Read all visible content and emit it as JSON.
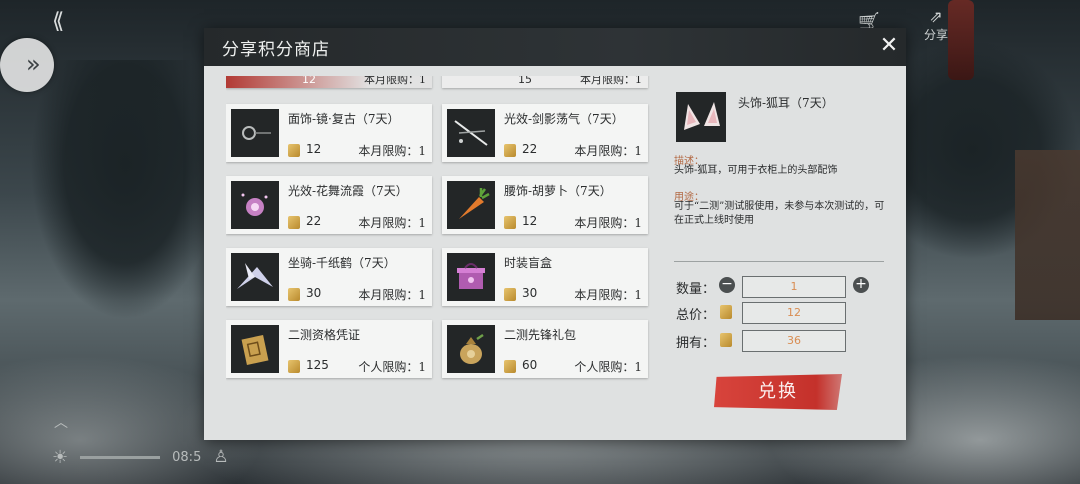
{
  "hud": {
    "time": "08:5",
    "share_label": "分享"
  },
  "shop": {
    "title": "分享积分商店",
    "items_partial": [
      {
        "price": "12",
        "limit": "本月限购：1"
      },
      {
        "price": "15",
        "limit": "本月限购：1"
      }
    ],
    "items": [
      {
        "name": "面饰-镜·复古（7天）",
        "price": "12",
        "limit": "本月限购：1",
        "icon": "monocle-icon"
      },
      {
        "name": "光效-剑影荡气（7天）",
        "price": "22",
        "limit": "本月限购：1",
        "icon": "sword-light-icon"
      },
      {
        "name": "光效-花舞流霞（7天）",
        "price": "22",
        "limit": "本月限购：1",
        "icon": "flower-light-icon"
      },
      {
        "name": "腰饰-胡萝卜（7天）",
        "price": "12",
        "limit": "本月限购：1",
        "icon": "carrot-icon"
      },
      {
        "name": "坐骑-千纸鹤（7天）",
        "price": "30",
        "limit": "本月限购：1",
        "icon": "paper-crane-icon"
      },
      {
        "name": "时装盲盒",
        "price": "30",
        "limit": "本月限购：1",
        "icon": "blind-box-icon"
      },
      {
        "name": "二测资格凭证",
        "price": "125",
        "limit": "个人限购：1",
        "icon": "scroll-voucher-icon"
      },
      {
        "name": "二测先锋礼包",
        "price": "60",
        "limit": "个人限购：1",
        "icon": "gift-bag-icon"
      }
    ],
    "detail": {
      "name": "头饰-狐耳（7天）",
      "icon": "fox-ears-icon",
      "desc_label": "描述：",
      "desc": "头饰-狐耳，可用于衣柜上的头部配饰",
      "usage_label": "用途：",
      "usage": "可于“二测”测试服使用，未参与本次测试的，可在正式上线时使用",
      "qty_label": "数量：",
      "qty": "1",
      "total_label": "总价：",
      "total": "12",
      "owned_label": "拥有：",
      "owned": "36",
      "exchange_label": "兑换"
    }
  },
  "colors": {
    "accent_red": "#c4312b",
    "value_orange": "#d98d52",
    "header": "#2a2e30"
  }
}
